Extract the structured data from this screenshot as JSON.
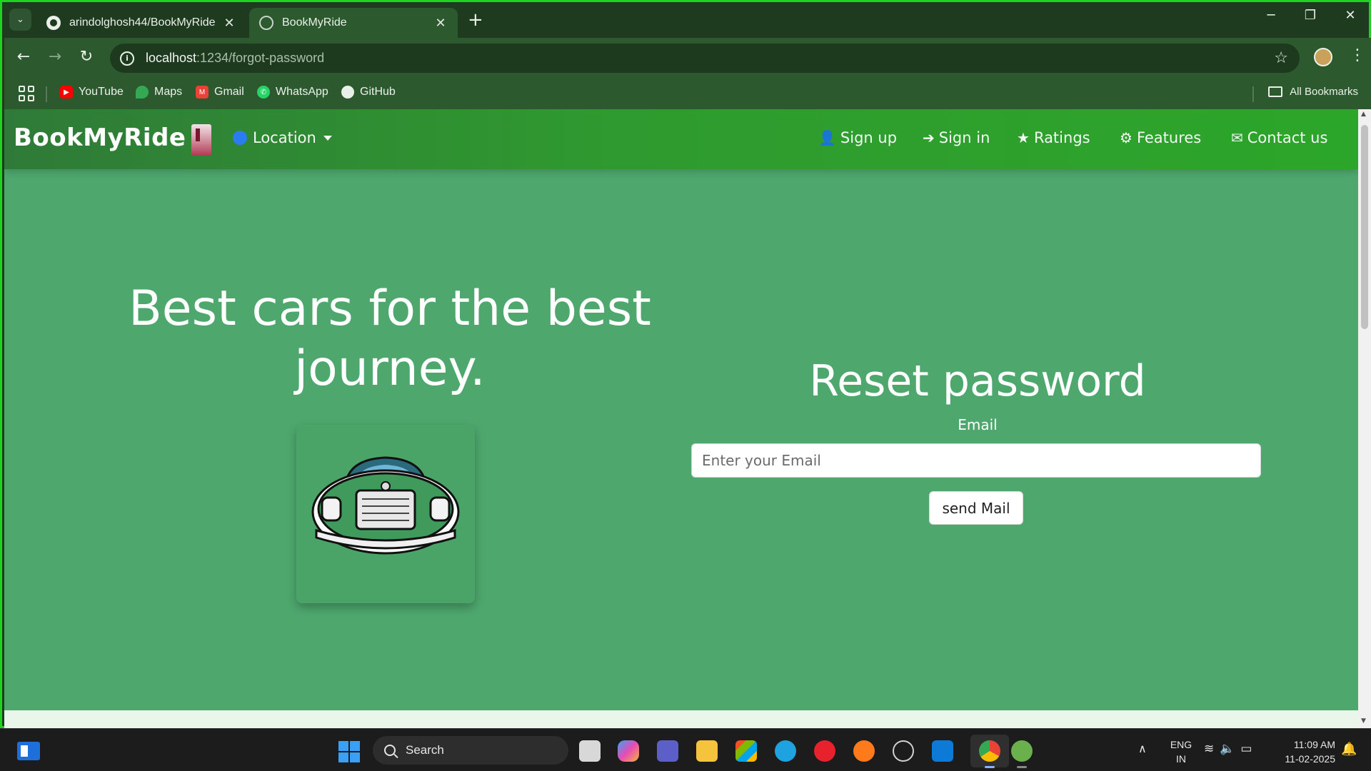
{
  "browser": {
    "tabs": [
      {
        "title": "arindolghosh44/BookMyRide",
        "active": false
      },
      {
        "title": "BookMyRide",
        "active": true
      }
    ],
    "new_tab": "+",
    "window_controls": {
      "minimize": "─",
      "restore": "❐",
      "close": "✕"
    },
    "url_host": "localhost",
    "url_path": ":1234/forgot-password",
    "bookmarks": [
      "YouTube",
      "Maps",
      "Gmail",
      "WhatsApp",
      "GitHub"
    ],
    "all_bookmarks": "All Bookmarks"
  },
  "site": {
    "brand": "BookMyRide",
    "location_label": "Location",
    "nav": [
      {
        "label": "Sign up",
        "icon": "user-plus-icon",
        "glyph": "👤"
      },
      {
        "label": "Sign in",
        "icon": "sign-in-icon",
        "glyph": "➔"
      },
      {
        "label": "Ratings",
        "icon": "star-icon",
        "glyph": "★"
      },
      {
        "label": "Features",
        "icon": "gears-icon",
        "glyph": "⚙"
      },
      {
        "label": "Contact us",
        "icon": "envelope-icon",
        "glyph": "✉"
      }
    ],
    "hero_title": "Best cars for the best journey.",
    "reset": {
      "title": "Reset password",
      "email_label": "Email",
      "email_placeholder": "Enter your Email",
      "email_value": "",
      "button": "send Mail"
    },
    "colors": {
      "page_bg": "#4ea86e",
      "nav_bg": "#2ca62a",
      "car_body": "#3f9a5b"
    }
  },
  "taskbar": {
    "search_label": "Search",
    "lang_top": "ENG",
    "lang_bottom": "IN",
    "time": "11:09 AM",
    "date": "11-02-2025"
  }
}
